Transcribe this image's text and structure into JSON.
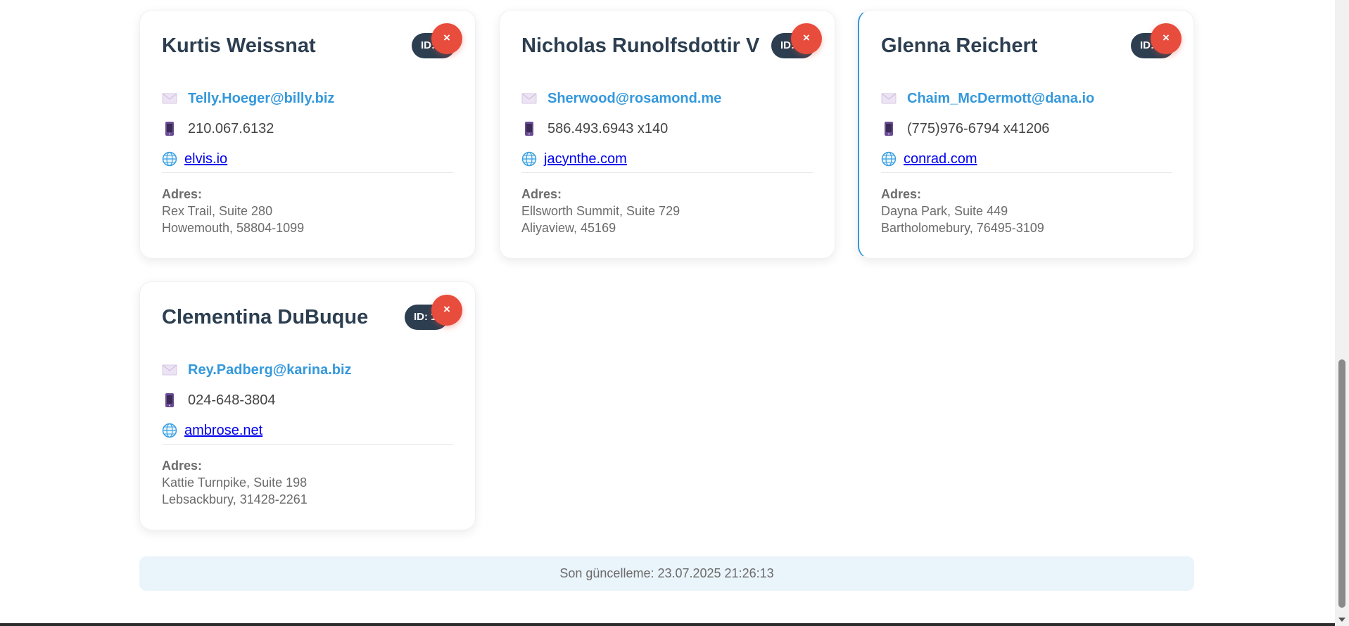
{
  "cards": [
    {
      "name": "Kurtis Weissnat",
      "id_label": "ID: 7",
      "delete_label": "×",
      "email": "Telly.Hoeger@billy.biz",
      "phone": "210.067.6132",
      "website": "elvis.io",
      "address_label": "Adres:",
      "address_line1": "Rex Trail, Suite 280",
      "address_line2": "Howemouth, 58804-1099"
    },
    {
      "name": "Nicholas Runolfsdottir V",
      "id_label": "ID: 8",
      "delete_label": "×",
      "email": "Sherwood@rosamond.me",
      "phone": "586.493.6943 x140",
      "website": "jacynthe.com",
      "address_label": "Adres:",
      "address_line1": "Ellsworth Summit, Suite 729",
      "address_line2": "Aliyaview, 45169"
    },
    {
      "name": "Glenna Reichert",
      "id_label": "ID: 9",
      "delete_label": "×",
      "email": "Chaim_McDermott@dana.io",
      "phone": "(775)976-6794 x41206",
      "website": "conrad.com",
      "address_label": "Adres:",
      "address_line1": "Dayna Park, Suite 449",
      "address_line2": "Bartholomebury, 76495-3109"
    },
    {
      "name": "Clementina DuBuque",
      "id_label": "ID: 10",
      "delete_label": "×",
      "email": "Rey.Padberg@karina.biz",
      "phone": "024-648-3804",
      "website": "ambrose.net",
      "address_label": "Adres:",
      "address_line1": "Kattie Turnpike, Suite 198",
      "address_line2": "Lebsackbury, 31428-2261"
    }
  ],
  "footer": {
    "last_updated": "Son güncelleme: 23.07.2025 21:26:13"
  },
  "icons": {
    "email": "envelope-icon",
    "phone": "mobile-phone-icon",
    "website": "globe-icon"
  },
  "colors": {
    "name": "#2c3e50",
    "email": "#3498db",
    "delete": "#e74c3c",
    "id_badge": "#2c3e50",
    "footer_bg": "#eaf4fb"
  }
}
